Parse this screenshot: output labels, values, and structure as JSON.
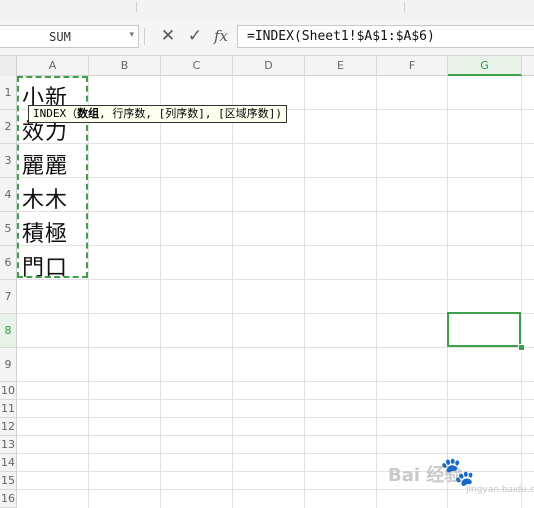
{
  "name_box": {
    "value": "SUM"
  },
  "formula_bar": {
    "cancel_icon": "✕",
    "confirm_icon": "✓",
    "fx_label": "fx",
    "formula": "=INDEX(Sheet1!$A$1:$A$6)"
  },
  "columns": [
    "A",
    "B",
    "C",
    "D",
    "E",
    "F",
    "G"
  ],
  "active_column": "G",
  "rows": [
    "1",
    "2",
    "3",
    "4",
    "5",
    "6",
    "7",
    "8",
    "9",
    "10",
    "11",
    "12",
    "13",
    "14",
    "15",
    "16"
  ],
  "active_row": "8",
  "cells": {
    "A1": "小新",
    "A2": "效力",
    "A3": "麗麗",
    "A4": "木木",
    "A5": "積極",
    "A6": "門口"
  },
  "tooltip": {
    "func": "INDEX",
    "arg_bold": "数组",
    "rest": "行序数, [列序数], [区域序数])"
  },
  "watermark": {
    "text": "Bai  经验",
    "sub": "jingyan.baidu.com"
  },
  "colors": {
    "accent": "#3ea04c",
    "header_bg": "#f4f4f4"
  }
}
